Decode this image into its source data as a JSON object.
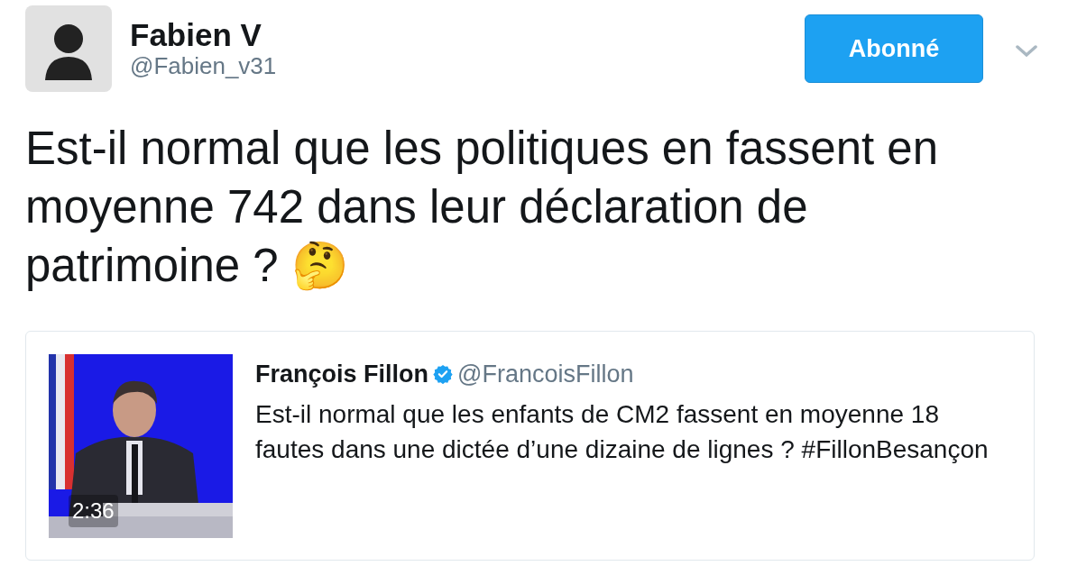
{
  "author": {
    "name": "Fabien V",
    "handle": "@Fabien_v31"
  },
  "follow_button": {
    "label": "Abonné"
  },
  "tweet_text": "Est-il normal que les politiques en fassent en moyenne 742 dans leur déclaration de patrimoine ? 🤔",
  "quoted_tweet": {
    "author_name": "François Fillon",
    "verified": true,
    "handle": "@FrancoisFillon",
    "text": "Est-il normal que les enfants de CM2 fassent en moyenne 18 fautes dans une dictée d’une dizaine de lignes ? #FillonBesançon",
    "media": {
      "kind": "picture",
      "duration": "2:36"
    }
  }
}
